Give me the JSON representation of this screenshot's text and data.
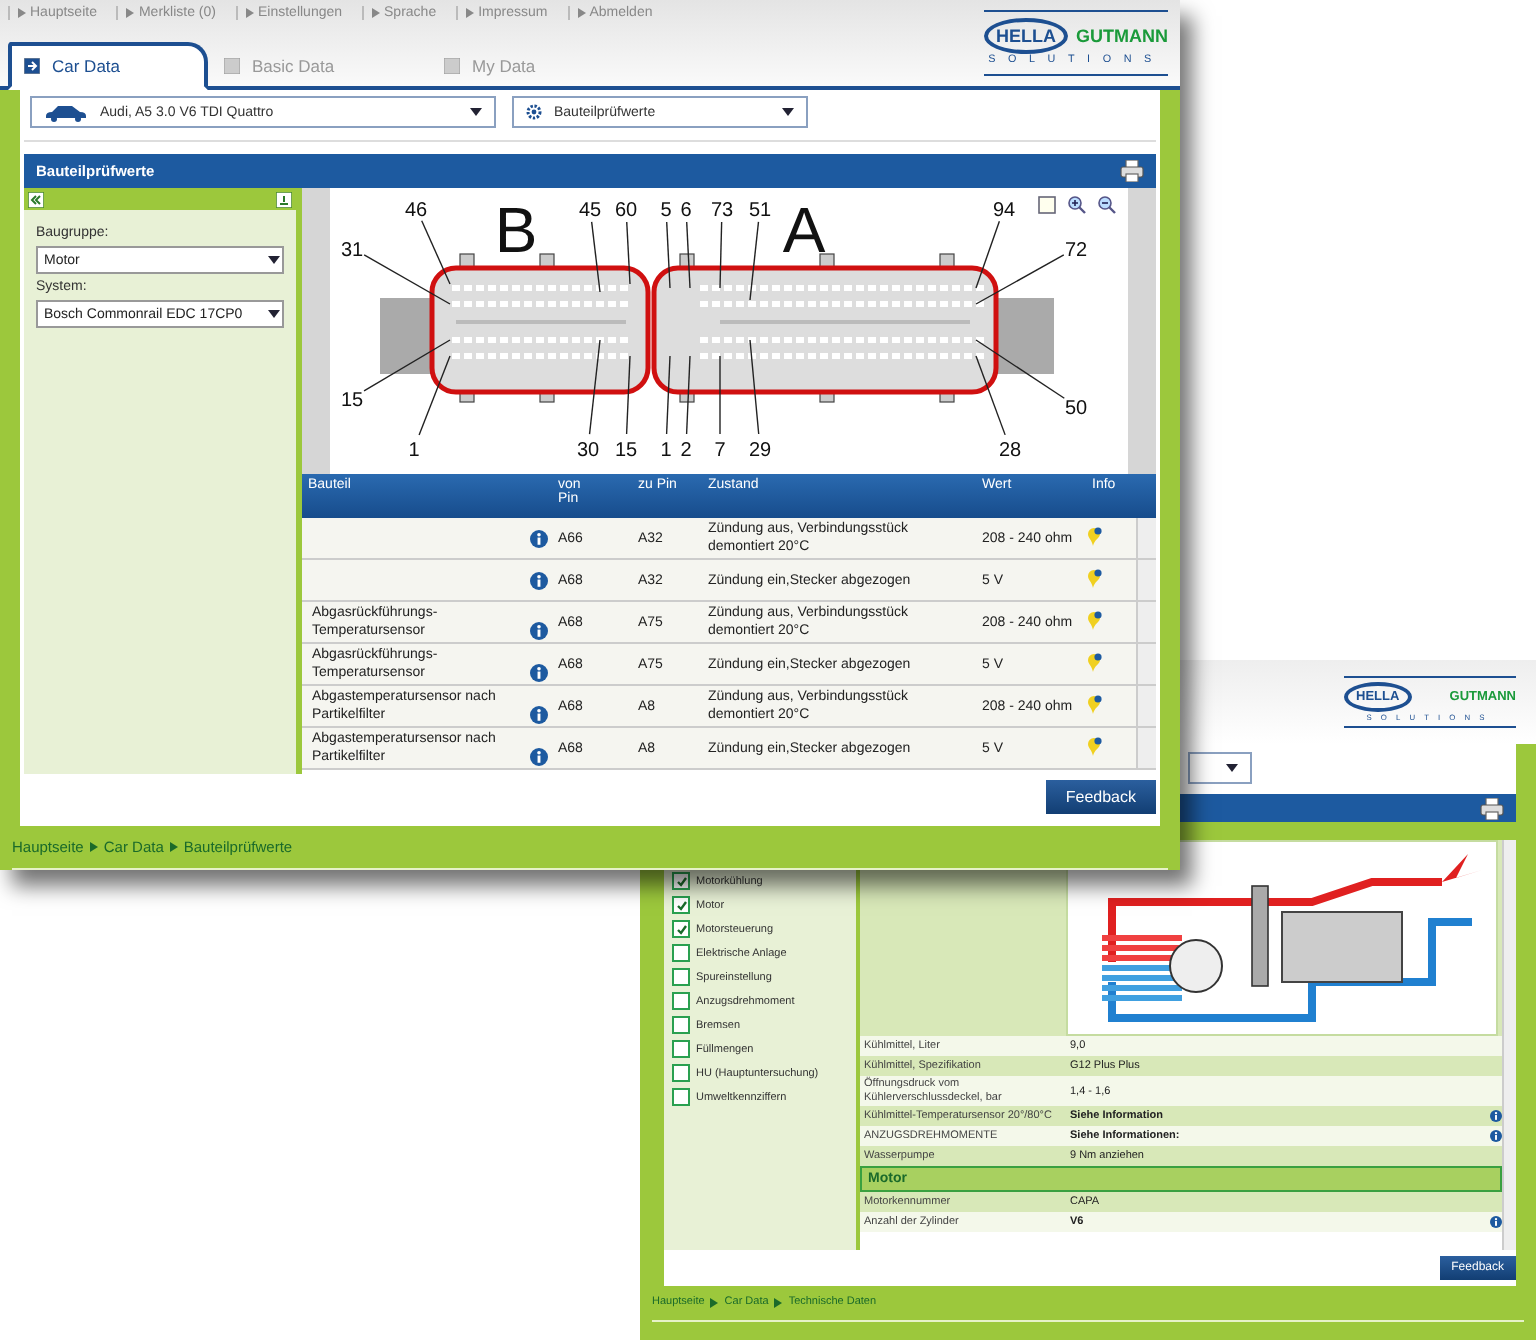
{
  "front_window": {
    "nav_links": [
      "Hauptseite",
      "Merkliste (0)",
      "Einstellungen",
      "Sprache",
      "Impressum",
      "Abmelden"
    ],
    "logo": {
      "mark": "HELLA",
      "wordmark": "GUTMANN",
      "tagline": "SOLUTIONS"
    },
    "tabs": [
      {
        "label": "Car Data",
        "selected": true
      },
      {
        "label": "Basic Data",
        "selected": false
      },
      {
        "label": "My Data",
        "selected": false
      }
    ],
    "vehicle_select": "Audi, A5 3.0 V6 TDI Quattro",
    "function_select": "Bauteilprüfwerte",
    "panel_title": "Bauteilprüfwerte",
    "filters": [
      {
        "label": "Baugruppe:",
        "value": "Motor"
      },
      {
        "label": "System:",
        "value": "Bosch Commonrail EDC 17CP0"
      }
    ],
    "connector": {
      "plug_labels": [
        "B",
        "A"
      ],
      "pin_labels": [
        "46",
        "45",
        "60",
        "5",
        "6",
        "73",
        "51",
        "94",
        "31",
        "72",
        "15",
        "50",
        "1",
        "30",
        "15",
        "1",
        "2",
        "7",
        "29",
        "28"
      ]
    },
    "table": {
      "columns": [
        "Bauteil",
        "von Pin",
        "zu Pin",
        "Zustand",
        "Wert",
        "Info"
      ],
      "rows": [
        {
          "von_pin": "A66",
          "zu_pin": "A32",
          "zustand": "Zündung aus, Verbindungsstück demontiert 20°C",
          "wert": "208 - 240 ohm"
        },
        {
          "von_pin": "A68",
          "zu_pin": "A32",
          "zustand": "Zündung ein,Stecker abgezogen",
          "wert": "5 V"
        },
        {
          "bauteil": "Abgasrückführungs-Temperatursensor",
          "von_pin": "A68",
          "zu_pin": "A75",
          "zustand": "Zündung aus, Verbindungsstück demontiert 20°C",
          "wert": "208 - 240 ohm"
        },
        {
          "bauteil": "Abgasrückführungs-Temperatursensor",
          "von_pin": "A68",
          "zu_pin": "A75",
          "zustand": "Zündung ein,Stecker abgezogen",
          "wert": "5 V"
        },
        {
          "bauteil": "Abgastemperatursensor nach Partikelfilter",
          "von_pin": "A68",
          "zu_pin": "A8",
          "zustand": "Zündung aus, Verbindungsstück demontiert 20°C",
          "wert": "208 - 240 ohm"
        },
        {
          "bauteil": "Abgastemperatursensor nach Partikelfilter",
          "von_pin": "A68",
          "zu_pin": "A8",
          "zustand": "Zündung ein,Stecker abgezogen",
          "wert": "5 V"
        }
      ]
    },
    "feedback": "Feedback",
    "breadcrumb": [
      "Hauptseite",
      "Car Data",
      "Bauteilprüfwerte"
    ]
  },
  "back_window": {
    "logo": {
      "mark": "HELLA",
      "wordmark": "GUTMANN",
      "tagline": "SOLUTIONS"
    },
    "categories": [
      {
        "label": "Motorkühlung",
        "checked": true
      },
      {
        "label": "Motor",
        "checked": true
      },
      {
        "label": "Motorsteuerung",
        "checked": true
      },
      {
        "label": "Elektrische Anlage",
        "checked": false
      },
      {
        "label": "Spureinstellung",
        "checked": false
      },
      {
        "label": "Anzugsdrehmoment",
        "checked": false
      },
      {
        "label": "Bremsen",
        "checked": false
      },
      {
        "label": "Füllmengen",
        "checked": false
      },
      {
        "label": "HU (Hauptuntersuchung)",
        "checked": false
      },
      {
        "label": "Umweltkennziffern",
        "checked": false
      }
    ],
    "specs": [
      {
        "kind": "text",
        "label": "Kühlmittel, Liter",
        "value": "9,0"
      },
      {
        "kind": "text",
        "label": "Kühlmittel, Spezifikation",
        "value": "G12 Plus Plus"
      },
      {
        "kind": "text",
        "label": "Öffnungsdruck vom Kühlerverschlussdeckel, bar",
        "value": "1,4 - 1,6"
      },
      {
        "kind": "link",
        "label": "Kühlmittel-Temperatursensor 20°/80°C",
        "value": "Siehe Information"
      },
      {
        "kind": "link",
        "label": "ANZUGSDREHMOMENTE",
        "value": "Siehe Informationen:"
      },
      {
        "kind": "text",
        "label": "Wasserpumpe",
        "value": "9 Nm anziehen"
      },
      {
        "kind": "section",
        "label": "Motor"
      },
      {
        "kind": "text",
        "label": "Motorkennummer",
        "value": "CAPA"
      },
      {
        "kind": "link",
        "label": "Anzahl der Zylinder",
        "value": "V6"
      }
    ],
    "feedback": "Feedback",
    "breadcrumb": [
      "Hauptseite",
      "Car Data",
      "Technische Daten"
    ]
  }
}
